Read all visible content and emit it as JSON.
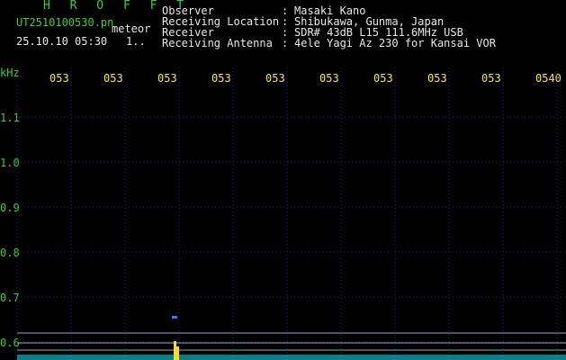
{
  "header": {
    "title": "H R O F F T",
    "filename": "UT2510100530.pn",
    "event_label": "meteor",
    "datetime": "25.10.10 05:30",
    "count": "1..",
    "observer_label": "Observer",
    "observer": "Masaki Kano",
    "location_label": "Receiving Location",
    "location": "Shibukawa, Gunma, Japan",
    "receiver_label": "Receiver",
    "receiver": "SDR# 43dB L15 111.6MHz USB",
    "antenna_label": "Receiving Antenna",
    "antenna": "4ele Yagi Az 230 for Kansai VOR",
    "separator": ":"
  },
  "axis": {
    "unit": "kHz",
    "time_ticks": [
      "053",
      "053",
      "053",
      "053",
      "053",
      "053",
      "053",
      "053",
      "053",
      "0540"
    ],
    "freq_ticks": [
      "1.1",
      "1.0",
      "0.9",
      "0.8",
      "0.7",
      "0.6"
    ]
  },
  "colors": {
    "background": "#000000",
    "grid": "#1e2a70",
    "label_green": "#36d23a",
    "tick_yellow": "#f0e84a",
    "noise": "#17e6f0",
    "echo": "#f0e020"
  }
}
